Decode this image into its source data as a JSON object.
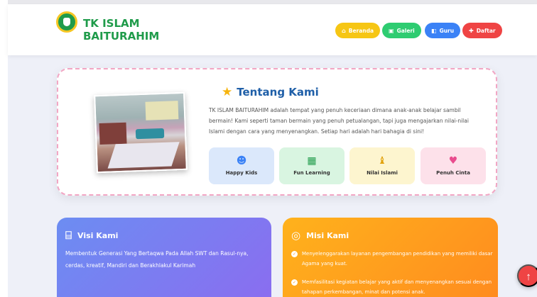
{
  "navbar": {
    "brand": "TK ISLAM\nBAITURAHIM",
    "brand_line1": "TK ISLAM",
    "brand_line2": "BAITURAHIM",
    "items": [
      {
        "label": "Beranda",
        "icon": "home-icon",
        "color": "#f6c614"
      },
      {
        "label": "Galeri",
        "icon": "gallery-icon",
        "color": "#2ecc71"
      },
      {
        "label": "Guru",
        "icon": "teacher-icon",
        "color": "#3b82f6"
      },
      {
        "label": "Daftar",
        "icon": "register-icon",
        "color": "#ef4444"
      }
    ]
  },
  "about": {
    "title": "Tentang Kami",
    "text": "TK ISLAM BAITURAHIM adalah tempat yang penuh keceriaan dimana anak-anak belajar sambil bermain! Kami seperti taman bermain yang penuh petualangan, tapi juga mengajarkan nilai-nilai Islami dengan cara yang menyenangkan. Setiap hari adalah hari bahagia di sini!",
    "features": [
      {
        "label": "Happy Kids",
        "icon": "smile-icon"
      },
      {
        "label": "Fun Learning",
        "icon": "book-icon"
      },
      {
        "label": "Nilai Islami",
        "icon": "pray-icon"
      },
      {
        "label": "Penuh Cinta",
        "icon": "heart-icon"
      }
    ]
  },
  "visi": {
    "title": "Visi Kami",
    "text": "Membentuk Generasi Yang Bertaqwa Pada Allah SWT dan Rasul-nya, cerdas, kreatif, Mandiri dan Berakhlakul Karimah"
  },
  "misi": {
    "title": "Misi Kami",
    "items": [
      "Menyelenggarakan layanan pengembangan pendidikan yang memiliki dasar Agama yang kuat.",
      "Memfasilitasi kegiatan belajar yang aktif dan menyenangkan sesuai dengan tahapan perkembangan, minat dan potensi anak."
    ]
  },
  "colors": {
    "brand": "#1f9b4a",
    "title_blue": "#1f5fa8",
    "visi_gradient_start": "#6c8df2",
    "misi_gradient_start": "#ffb21c",
    "scroll_top": "#ef4444"
  }
}
